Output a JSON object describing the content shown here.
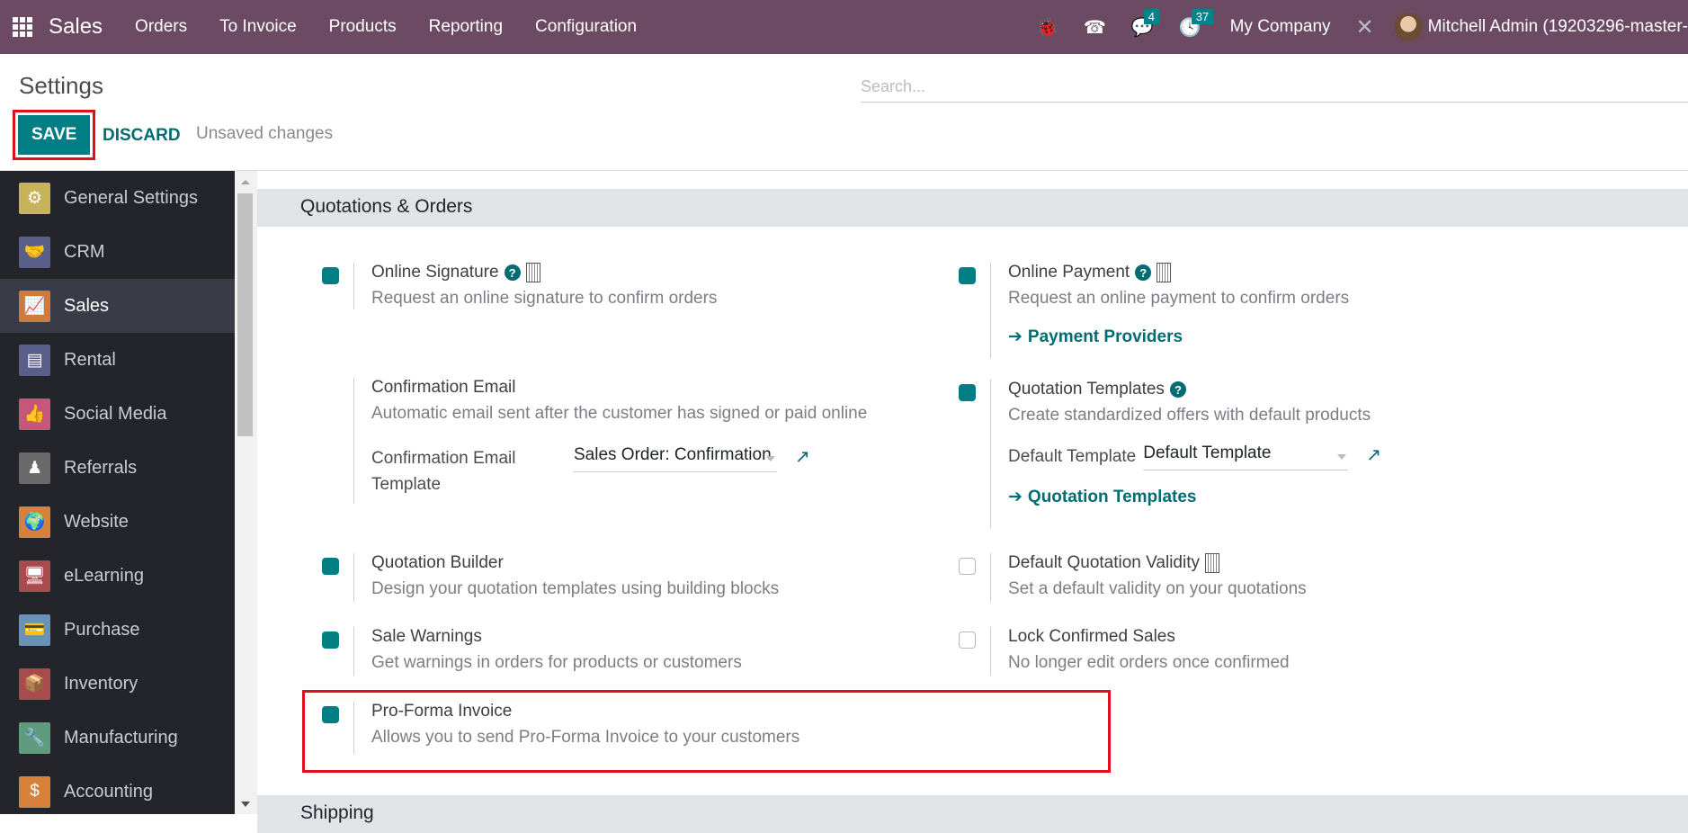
{
  "navbar": {
    "app_name": "Sales",
    "menu": [
      "Orders",
      "To Invoice",
      "Products",
      "Reporting",
      "Configuration"
    ],
    "messages_badge": "4",
    "activities_badge": "37",
    "company": "My Company",
    "user": "Mitchell Admin (19203296-master-"
  },
  "control_panel": {
    "title": "Settings",
    "search_placeholder": "Search...",
    "save_label": "SAVE",
    "discard_label": "DISCARD",
    "status": "Unsaved changes"
  },
  "sidebar": {
    "items": [
      {
        "label": "General Settings",
        "icon": "gear-icon",
        "glyph": "⚙",
        "color": "#c6b35a"
      },
      {
        "label": "CRM",
        "icon": "handshake-icon",
        "glyph": "🤝",
        "color": "#5a5f8a"
      },
      {
        "label": "Sales",
        "icon": "chart-trend-icon",
        "glyph": "📈",
        "color": "#d07a3c",
        "active": true
      },
      {
        "label": "Rental",
        "icon": "rental-icon",
        "glyph": "▤",
        "color": "#5a5f8a"
      },
      {
        "label": "Social Media",
        "icon": "thumbs-up-icon",
        "glyph": "👍",
        "color": "#c8557a"
      },
      {
        "label": "Referrals",
        "icon": "referrals-icon",
        "glyph": "♟",
        "color": "#6a6a6a"
      },
      {
        "label": "Website",
        "icon": "globe-icon",
        "glyph": "🌍",
        "color": "#d8813a"
      },
      {
        "label": "eLearning",
        "icon": "elearning-icon",
        "glyph": "🖥",
        "color": "#a84a4e"
      },
      {
        "label": "Purchase",
        "icon": "credit-card-icon",
        "glyph": "💳",
        "color": "#6a92b8"
      },
      {
        "label": "Inventory",
        "icon": "box-icon",
        "glyph": "📦",
        "color": "#a84a4e"
      },
      {
        "label": "Manufacturing",
        "icon": "wrench-icon",
        "glyph": "🔧",
        "color": "#5e9c7d"
      },
      {
        "label": "Accounting",
        "icon": "invoice-dollar-icon",
        "glyph": "$",
        "color": "#d8813a"
      }
    ]
  },
  "sections": {
    "quotations": "Quotations & Orders",
    "shipping": "Shipping"
  },
  "settings": {
    "online_signature": {
      "title": "Online Signature",
      "desc": "Request an online signature to confirm orders",
      "checked": true
    },
    "online_payment": {
      "title": "Online Payment",
      "desc": "Request an online payment to confirm orders",
      "link": "Payment Providers",
      "checked": true
    },
    "confirmation_email": {
      "title": "Confirmation Email",
      "desc": "Automatic email sent after the customer has signed or paid online",
      "field_label": "Confirmation Email Template",
      "field_value": "Sales Order: Confirmation"
    },
    "quotation_templates": {
      "title": "Quotation Templates",
      "desc": "Create standardized offers with default products",
      "field_label": "Default Template",
      "field_value": "Default Template",
      "link": "Quotation Templates",
      "checked": true
    },
    "quotation_builder": {
      "title": "Quotation Builder",
      "desc": "Design your quotation templates using building blocks",
      "checked": true
    },
    "default_validity": {
      "title": "Default Quotation Validity",
      "desc": "Set a default validity on your quotations",
      "checked": false
    },
    "sale_warnings": {
      "title": "Sale Warnings",
      "desc": "Get warnings in orders for products or customers",
      "checked": true
    },
    "lock_confirmed": {
      "title": "Lock Confirmed Sales",
      "desc": "No longer edit orders once confirmed",
      "checked": false
    },
    "pro_forma": {
      "title": "Pro-Forma Invoice",
      "desc": "Allows you to send Pro-Forma Invoice to your customers",
      "checked": true
    }
  },
  "colors": {
    "navbar": "#6c4a63",
    "accent": "#017e84",
    "highlight": "#e0101a"
  }
}
